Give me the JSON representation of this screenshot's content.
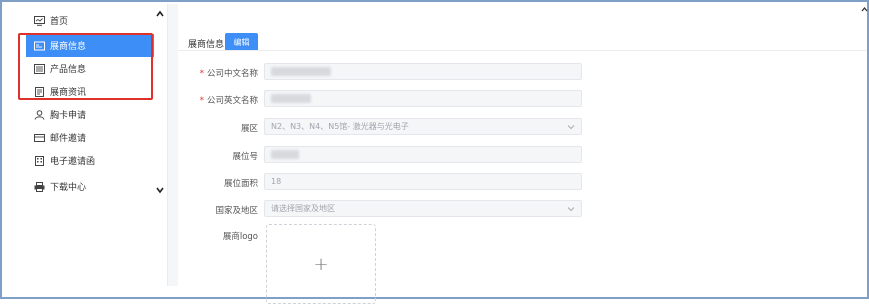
{
  "sidebar": {
    "items": [
      {
        "label": "首页",
        "icon": "monitor-icon"
      },
      {
        "label": "展商信息",
        "icon": "id-card-icon",
        "active": true
      },
      {
        "label": "产品信息",
        "icon": "list-icon"
      },
      {
        "label": "展商资讯",
        "icon": "document-icon"
      },
      {
        "label": "胸卡申请",
        "icon": "user-icon"
      },
      {
        "label": "邮件邀请",
        "icon": "mail-icon"
      },
      {
        "label": "电子邀请函",
        "icon": "building-icon"
      },
      {
        "label": "下载中心",
        "icon": "printer-icon"
      }
    ]
  },
  "header": {
    "title": "展商信息",
    "edit_label": "编辑"
  },
  "form": {
    "company_cn": {
      "label": "公司中文名称",
      "required": true
    },
    "company_en": {
      "label": "公司英文名称",
      "required": true
    },
    "hall": {
      "label": "展区",
      "value": "N2、N3、N4、N5馆- 激光器与光电子"
    },
    "booth_no": {
      "label": "展位号"
    },
    "booth_area": {
      "label": "展位面积",
      "value": "18"
    },
    "country": {
      "label": "国家及地区",
      "placeholder": "请选择国家及地区"
    },
    "logo": {
      "label": "展商logo",
      "upload_symbol": "+"
    }
  },
  "colors": {
    "accent": "#3e8ef7",
    "highlight": "#e0302b",
    "required": "#e0302b"
  }
}
